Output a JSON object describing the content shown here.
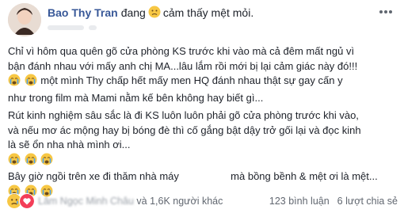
{
  "header": {
    "author": "Bao Thy Tran",
    "verb": "đang",
    "feeling": "cảm thấy mệt mỏi."
  },
  "content": {
    "paragraphs": [
      [
        "Chỉ vì hôm qua quên gõ cửa phòng KS trước khi vào mà cả đêm mất ngủ vì",
        "bận đánh nhau với mấy anh chị MA...lâu lắm rồi mới bị lại cảm giác này đó!!!",
        "một mình Thy chấp hết mấy men HQ đánh nhau thật sự gay cấn y",
        "như trong film mà Mami nằm kế bên không hay biết gì..."
      ],
      [
        "Rút kinh nghiệm sâu sắc là đi KS luôn luôn phải gõ cửa phòng trước khi vào,",
        "và nếu mơ ác mộng hay bị bóng đè thì cố gắng bật dậy trở gối lại và đọc kinh",
        "là sẽ ổn nha nhà mình ơi...",
        "Bây giờ ngồi trên xe đi thăm nhà máy",
        "mà bồng bềnh & mệt ơi là mệt..."
      ]
    ]
  },
  "footer": {
    "reactors_name": "Lâm Ngọc Minh Châu",
    "reactors_rest": "và 1,6K người khác",
    "comments": "123 bình luận",
    "shares": "6 lượt chia sẻ"
  },
  "colors": {
    "name_blue": "#385898",
    "text": "#1d2129",
    "meta": "#616770",
    "like_blue": "#1877f2",
    "sad_yellow": "#f7c744",
    "love_red": "#f33e58"
  },
  "icons": [
    "sad-face-icon",
    "crying-face-icon",
    "more-dots-icon",
    "sad-reaction-icon",
    "love-reaction-icon"
  ]
}
